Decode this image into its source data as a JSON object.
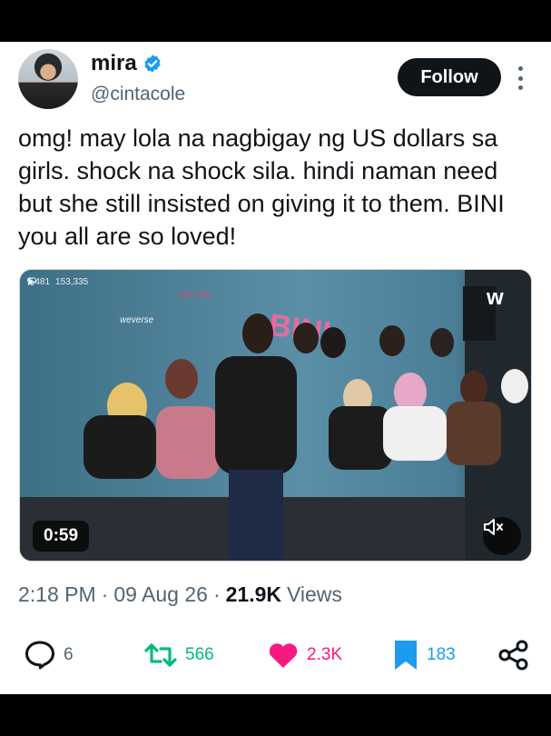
{
  "tweet": {
    "author_name": "mira",
    "author_handle": "@cintacole",
    "follow_label": "Follow",
    "text": "omg! may lola na nagbigay ng US dollars sa girls. shock na shock sila. hindi naman need but she still insisted on giving it to them. BINI you all are so loved!",
    "time": "2:18 PM",
    "date": "09 Aug 26",
    "separator": "·",
    "views_count": "21.9K",
    "views_label": "Views"
  },
  "media": {
    "duration": "0:59",
    "plays": "5,481",
    "likes": "153,335",
    "banner_text": "BINI",
    "backdrop_logos": [
      "ABS-CBN",
      "weverse"
    ],
    "corner_logo": "w"
  },
  "actions": {
    "replies": "6",
    "reposts": "566",
    "likes": "2.3K",
    "bookmarks": "183"
  },
  "colors": {
    "text_primary": "#0f1419",
    "text_secondary": "#536471",
    "verified": "#1d9bf0",
    "repost": "#00ba7c",
    "like": "#f91880",
    "bookmark": "#1d9bf0"
  },
  "icons": [
    "verified-badge-icon",
    "more-icon",
    "play-icon",
    "heart-icon",
    "mute-icon",
    "reply-icon",
    "repost-icon",
    "like-icon",
    "bookmark-icon",
    "share-icon"
  ]
}
